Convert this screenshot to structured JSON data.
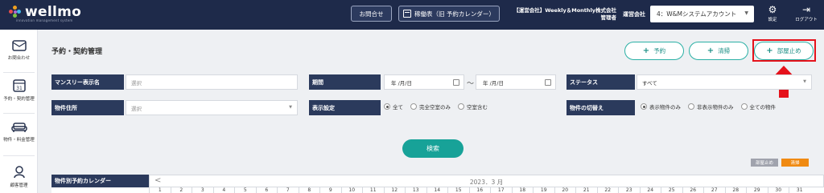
{
  "header": {
    "logo_text": "wellmo",
    "logo_sub": "innovation management system",
    "inquiry_button": "お問合せ",
    "calendar_button": "稼働表（旧 予約カレンダー）",
    "company_line1": "【運営会社】Weekly＆Monthly株式会社",
    "company_line2": "管理者",
    "operator_label": "運営会社",
    "operator_value": "4：W&Mシステムアカウント",
    "settings_label": "設定",
    "logout_label": "ログアウト"
  },
  "sidebar": {
    "items": [
      {
        "label": "お問合わせ",
        "icon": "envelope-icon"
      },
      {
        "label": "予約・契約管理",
        "icon": "calendar-icon"
      },
      {
        "label": "物件・料金管理",
        "icon": "sofa-icon"
      },
      {
        "label": "顧客管理",
        "icon": "person-icon"
      }
    ]
  },
  "main": {
    "page_title": "予約・契約管理",
    "buttons": {
      "reserve": "予約",
      "cleaning": "清掃",
      "room_block": "部屋止め"
    },
    "filters": {
      "monthly_name_label": "マンスリー表示名",
      "monthly_name_placeholder": "選択",
      "period_label": "期間",
      "date_from": "年 /月/日",
      "date_to": "年 /月/日",
      "tilde": "〜",
      "status_label": "ステータス",
      "status_value": "すべて",
      "address_label": "物件住所",
      "address_placeholder": "選択",
      "display_setting_label": "表示設定",
      "display_options": [
        "全て",
        "完全空室のみ",
        "空室含む"
      ],
      "property_switch_label": "物件の切替え",
      "property_options": [
        "表示物件のみ",
        "非表示物件のみ",
        "全ての物件"
      ]
    },
    "search_button": "検索",
    "legend": {
      "room_block": "部屋止め",
      "cleaning": "清掃"
    },
    "calendar": {
      "title": "物件別予約カレンダー",
      "month": "2023．3 月",
      "prev": "<",
      "days": [
        "1",
        "2",
        "3",
        "4",
        "5",
        "6",
        "7",
        "8",
        "9",
        "10",
        "11",
        "12",
        "13",
        "14",
        "15",
        "16",
        "17",
        "18",
        "19",
        "20",
        "21",
        "22",
        "23",
        "24",
        "25",
        "26",
        "27",
        "28",
        "29",
        "30",
        "31"
      ]
    }
  },
  "colors": {
    "header_bg": "#1e2a4a",
    "label_bg": "#2b3a5c",
    "accent_teal": "#17a298",
    "highlight_red": "#e5121b",
    "legend_block": "#a0a3ad",
    "legend_cleaning": "#f08a12"
  }
}
